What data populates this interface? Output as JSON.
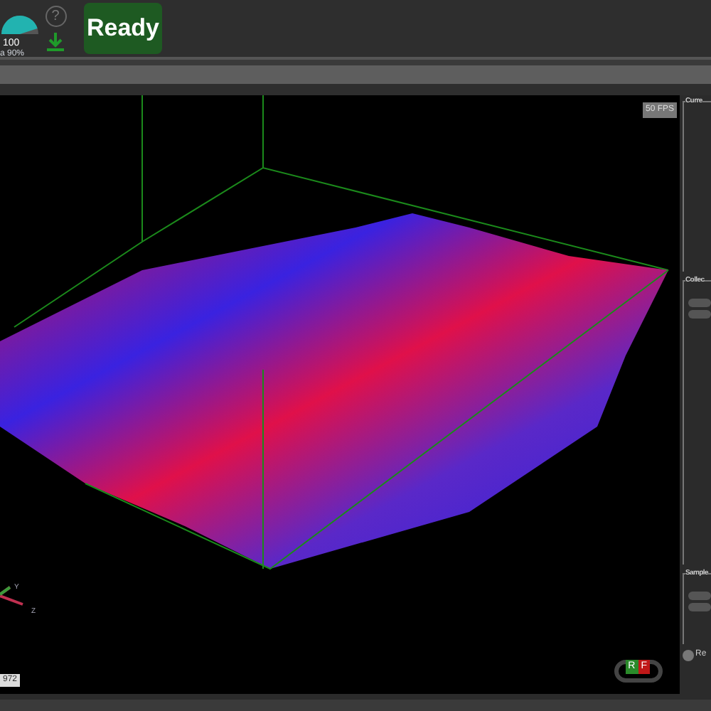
{
  "toolbar": {
    "gauge": {
      "max": "100",
      "reading": "a 90%",
      "level": 0.9
    },
    "help": "?",
    "status": "Ready"
  },
  "viewport": {
    "fps": "50 FPS",
    "axes": [
      "Y",
      "Z"
    ],
    "corner_label": "972",
    "cube_faces": [
      "R",
      "F"
    ]
  },
  "side_panel": {
    "groups": [
      "Curre",
      "Collec",
      "Sample"
    ],
    "toggle": "Re"
  }
}
